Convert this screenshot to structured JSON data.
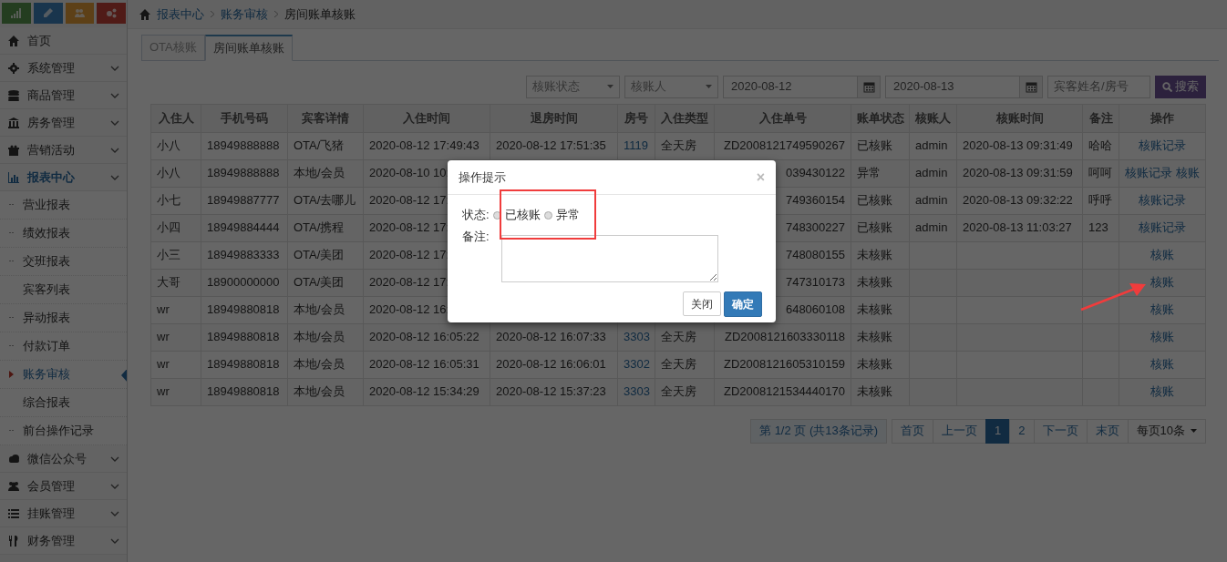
{
  "sidebar": {
    "items": [
      {
        "label": "首页",
        "has_submenu": false,
        "selected": false
      },
      {
        "label": "系统管理",
        "has_submenu": true,
        "selected": false
      },
      {
        "label": "商品管理",
        "has_submenu": true,
        "selected": false
      },
      {
        "label": "房务管理",
        "has_submenu": true,
        "selected": false
      },
      {
        "label": "营销活动",
        "has_submenu": true,
        "selected": false
      },
      {
        "label": "报表中心",
        "has_submenu": true,
        "selected": true,
        "children": [
          {
            "label": "营业报表",
            "dot": true,
            "selected": false
          },
          {
            "label": "绩效报表",
            "dot": true,
            "selected": false
          },
          {
            "label": "交班报表",
            "dot": true,
            "selected": false
          },
          {
            "label": "宾客列表",
            "dot": false,
            "selected": false
          },
          {
            "label": "异动报表",
            "dot": true,
            "selected": false
          },
          {
            "label": "付款订单",
            "dot": true,
            "selected": false
          },
          {
            "label": "账务审核",
            "dot": false,
            "selected": true
          },
          {
            "label": "综合报表",
            "dot": false,
            "selected": false
          },
          {
            "label": "前台操作记录",
            "dot": true,
            "selected": false
          }
        ]
      },
      {
        "label": "微信公众号",
        "has_submenu": true,
        "selected": false
      },
      {
        "label": "会员管理",
        "has_submenu": true,
        "selected": false
      },
      {
        "label": "挂账管理",
        "has_submenu": true,
        "selected": false
      },
      {
        "label": "财务管理",
        "has_submenu": true,
        "selected": false
      }
    ]
  },
  "breadcrumb": [
    "报表中心",
    "账务审核",
    "房间账单核账"
  ],
  "tabs": [
    {
      "label": "OTA核账",
      "selected": false
    },
    {
      "label": "房间账单核账",
      "selected": true
    }
  ],
  "filters": {
    "status_select": "核账状态",
    "checker_select": "核账人",
    "date_from": "2020-08-12",
    "date_to": "2020-08-13",
    "search": {
      "placeholder": "宾客姓名/房号"
    },
    "search_button": "搜索"
  },
  "table": {
    "columns": [
      "入住人",
      "手机号码",
      "宾客详情",
      "入住时间",
      "退房时间",
      "房号",
      "入住类型",
      "入住单号",
      "账单状态",
      "核账人",
      "核账时间",
      "备注",
      "操作"
    ],
    "rows": [
      [
        "小八",
        "18949888888",
        "OTA/飞猪",
        "2020-08-12 17:49:43",
        "2020-08-12 17:51:35",
        "1119",
        "全天房",
        "ZD2008121749590267",
        "已核账",
        "admin",
        "2020-08-13 09:31:49",
        "哈哈",
        [
          "核账记录"
        ]
      ],
      [
        "小八",
        "18949888888",
        "本地/会员",
        "2020-08-10 10:",
        null,
        null,
        null,
        "039430122",
        "异常",
        "admin",
        "2020-08-13 09:31:59",
        "呵呵",
        [
          "核账记录",
          "核账"
        ]
      ],
      [
        "小七",
        "18949887777",
        "OTA/去哪儿",
        "2020-08-12 17:",
        null,
        null,
        null,
        "749360154",
        "已核账",
        "admin",
        "2020-08-13 09:32:22",
        "呼呼",
        [
          "核账记录"
        ]
      ],
      [
        "小四",
        "18949884444",
        "OTA/携程",
        "2020-08-12 17:",
        null,
        null,
        null,
        "748300227",
        "已核账",
        "admin",
        "2020-08-13 11:03:27",
        "123",
        [
          "核账记录"
        ]
      ],
      [
        "小三",
        "18949883333",
        "OTA/美团",
        "2020-08-12 17:",
        null,
        null,
        null,
        "748080155",
        "未核账",
        null,
        null,
        null,
        [
          "核账"
        ]
      ],
      [
        "大哥",
        "18900000000",
        "OTA/美团",
        "2020-08-12 17:",
        null,
        null,
        null,
        "747310173",
        "未核账",
        null,
        null,
        null,
        [
          "核账"
        ]
      ],
      [
        "wr",
        "18949880818",
        "本地/会员",
        "2020-08-12 16:",
        null,
        null,
        null,
        "648060108",
        "未核账",
        null,
        null,
        null,
        [
          "核账"
        ]
      ],
      [
        "wr",
        "18949880818",
        "本地/会员",
        "2020-08-12 16:05:22",
        "2020-08-12 16:07:33",
        "3303",
        "全天房",
        "ZD2008121603330118",
        "未核账",
        null,
        null,
        null,
        [
          "核账"
        ]
      ],
      [
        "wr",
        "18949880818",
        "本地/会员",
        "2020-08-12 16:05:31",
        "2020-08-12 16:06:01",
        "3302",
        "全天房",
        "ZD2008121605310159",
        "未核账",
        null,
        null,
        null,
        [
          "核账"
        ]
      ],
      [
        "wr",
        "18949880818",
        "本地/会员",
        "2020-08-12 15:34:29",
        "2020-08-12 15:37:23",
        "3303",
        "全天房",
        "ZD2008121534440170",
        "未核账",
        null,
        null,
        null,
        [
          "核账"
        ]
      ]
    ]
  },
  "pagination": {
    "info": "第 1/2 页 (共13条记录)",
    "buttons": [
      {
        "label": "首页",
        "selected": false
      },
      {
        "label": "上一页",
        "selected": false
      },
      {
        "label": "1",
        "selected": true
      },
      {
        "label": "2",
        "selected": false
      },
      {
        "label": "下一页",
        "selected": false
      },
      {
        "label": "末页",
        "selected": false
      }
    ],
    "page_size": "每页10条"
  },
  "modal": {
    "title": "操作提示",
    "close": "×",
    "status_label": "状态:",
    "options": [
      {
        "label": "已核账",
        "selected": false
      },
      {
        "label": "异常",
        "selected": false
      }
    ],
    "note_label": "备注:",
    "buttons": [
      {
        "label": "关闭",
        "kind": "default"
      },
      {
        "label": "确定",
        "kind": "primary"
      }
    ]
  }
}
